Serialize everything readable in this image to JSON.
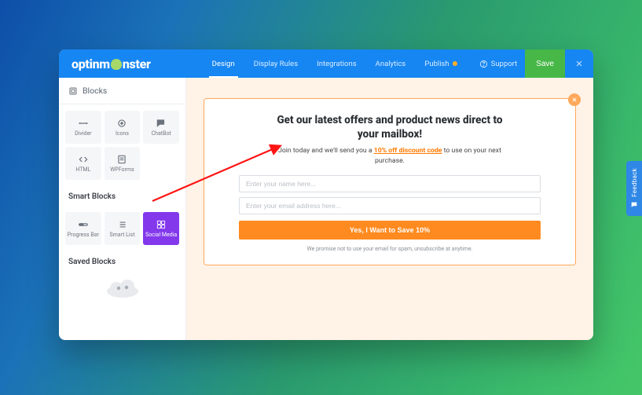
{
  "brand": {
    "name_left": "optinm",
    "name_right": "nster"
  },
  "nav": {
    "tabs": [
      "Design",
      "Display Rules",
      "Integrations",
      "Analytics",
      "Publish"
    ],
    "active_index": 0,
    "support_label": "Support",
    "save_label": "Save"
  },
  "sidebar": {
    "blocks_header": "Blocks",
    "blocks": [
      {
        "label": "Divider",
        "icon": "divider-icon"
      },
      {
        "label": "Icons",
        "icon": "icons-icon"
      },
      {
        "label": "ChatBot",
        "icon": "chatbot-icon"
      },
      {
        "label": "HTML",
        "icon": "html-icon"
      },
      {
        "label": "WPForms",
        "icon": "wpforms-icon"
      }
    ],
    "smart_header": "Smart Blocks",
    "smart_blocks": [
      {
        "label": "Progress Bar",
        "icon": "progress-bar-icon"
      },
      {
        "label": "Smart List",
        "icon": "smart-list-icon"
      },
      {
        "label": "Social Media",
        "icon": "social-media-icon",
        "selected": true
      }
    ],
    "saved_header": "Saved Blocks"
  },
  "popup": {
    "heading": "Get our latest offers and product news direct to your mailbox!",
    "sub_before": "Join today and we'll send you a ",
    "sub_highlight": "10% off discount code",
    "sub_after": " to use on your next purchase.",
    "name_placeholder": "Enter your name here...",
    "email_placeholder": "Enter your email address here...",
    "cta_label": "Yes, I Want to Save 10%",
    "fineprint": "We promise not to use your email for spam, unsubscribe at anytime."
  },
  "feedback": {
    "label": "Feedback"
  },
  "colors": {
    "accent_orange": "#ff8a1f",
    "brand_blue": "#1686f3",
    "save_green": "#47b747",
    "selected_purple": "#8338ec"
  }
}
